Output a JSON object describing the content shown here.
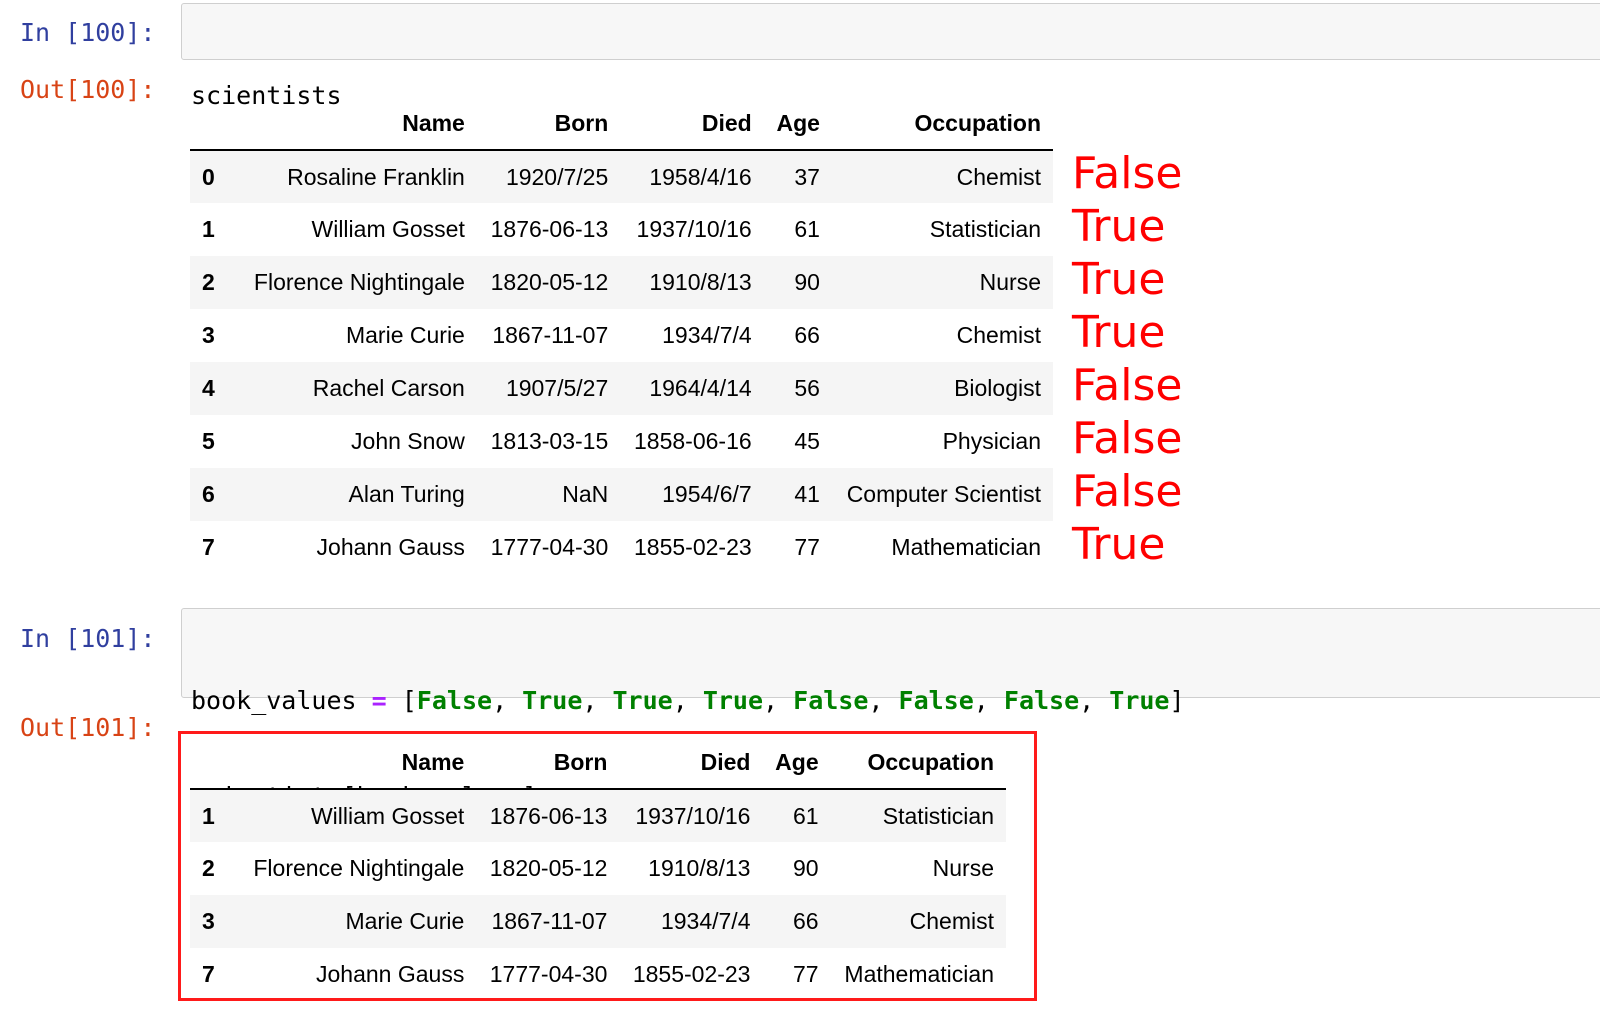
{
  "cell1": {
    "in_prompt": "In [100]:",
    "code": "scientists",
    "out_prompt": "Out[100]:"
  },
  "df1": {
    "columns": [
      "Name",
      "Born",
      "Died",
      "Age",
      "Occupation"
    ],
    "rows": [
      {
        "index": "0",
        "Name": "Rosaline Franklin",
        "Born": "1920/7/25",
        "Died": "1958/4/16",
        "Age": "37",
        "Occupation": "Chemist"
      },
      {
        "index": "1",
        "Name": "William Gosset",
        "Born": "1876-06-13",
        "Died": "1937/10/16",
        "Age": "61",
        "Occupation": "Statistician"
      },
      {
        "index": "2",
        "Name": "Florence Nightingale",
        "Born": "1820-05-12",
        "Died": "1910/8/13",
        "Age": "90",
        "Occupation": "Nurse"
      },
      {
        "index": "3",
        "Name": "Marie Curie",
        "Born": "1867-11-07",
        "Died": "1934/7/4",
        "Age": "66",
        "Occupation": "Chemist"
      },
      {
        "index": "4",
        "Name": "Rachel Carson",
        "Born": "1907/5/27",
        "Died": "1964/4/14",
        "Age": "56",
        "Occupation": "Biologist"
      },
      {
        "index": "5",
        "Name": "John Snow",
        "Born": "1813-03-15",
        "Died": "1858-06-16",
        "Age": "45",
        "Occupation": "Physician"
      },
      {
        "index": "6",
        "Name": "Alan Turing",
        "Born": "NaN",
        "Died": "1954/6/7",
        "Age": "41",
        "Occupation": "Computer Scientist"
      },
      {
        "index": "7",
        "Name": "Johann Gauss",
        "Born": "1777-04-30",
        "Died": "1855-02-23",
        "Age": "77",
        "Occupation": "Mathematician"
      }
    ]
  },
  "annotations": [
    "False",
    "True",
    "True",
    "True",
    "False",
    "False",
    "False",
    "True"
  ],
  "cell2": {
    "in_prompt": "In [101]:",
    "code_line1": {
      "var": "book_values ",
      "op": "=",
      "open": " [",
      "values": [
        "False",
        "True",
        "True",
        "True",
        "False",
        "False",
        "False",
        "True"
      ],
      "sep": ", ",
      "close": "]"
    },
    "code_line2": "scientists[book_values]",
    "out_prompt": "Out[101]:"
  },
  "df2": {
    "columns": [
      "Name",
      "Born",
      "Died",
      "Age",
      "Occupation"
    ],
    "rows": [
      {
        "index": "1",
        "Name": "William Gosset",
        "Born": "1876-06-13",
        "Died": "1937/10/16",
        "Age": "61",
        "Occupation": "Statistician"
      },
      {
        "index": "2",
        "Name": "Florence Nightingale",
        "Born": "1820-05-12",
        "Died": "1910/8/13",
        "Age": "90",
        "Occupation": "Nurse"
      },
      {
        "index": "3",
        "Name": "Marie Curie",
        "Born": "1867-11-07",
        "Died": "1934/7/4",
        "Age": "66",
        "Occupation": "Chemist"
      },
      {
        "index": "7",
        "Name": "Johann Gauss",
        "Born": "1777-04-30",
        "Died": "1855-02-23",
        "Age": "77",
        "Occupation": "Mathematician"
      }
    ]
  },
  "colors": {
    "prompt_in": "#303f9f",
    "prompt_out": "#d84315",
    "annotation": "#ff0000",
    "highlight_border": "#ff1a1a",
    "keyword": "#008000",
    "operator": "#aa22ff"
  }
}
